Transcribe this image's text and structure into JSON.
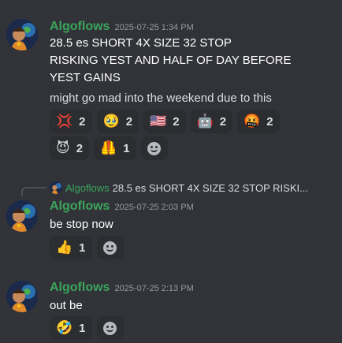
{
  "colors": {
    "background": "#313338",
    "author": "#3ba55c",
    "timestamp": "#949ba4",
    "reaction_bg": "#2b2d31"
  },
  "messages": [
    {
      "author": "Algoflows",
      "timestamp": "2025-07-25 1:34 PM",
      "lines": [
        "28.5 es SHORT 4X SIZE 32 STOP",
        "RISKING YEST  AND HALF OF DAY BEFORE",
        "YEST GAINS",
        "might go mad into the weekend due to this"
      ],
      "reactions_row1": [
        {
          "emoji": "💢",
          "icon": "anger-icon",
          "count": "2"
        },
        {
          "emoji": "🥹",
          "icon": "holding-back-tears-icon",
          "count": "2"
        },
        {
          "emoji": "🇺🇸",
          "icon": "us-flag-icon",
          "count": "2"
        },
        {
          "emoji": "🤖",
          "icon": "robot-icon",
          "count": "2"
        },
        {
          "emoji": "🤬",
          "icon": "cursing-face-icon",
          "count": "2"
        }
      ],
      "reactions_row2": [
        {
          "emoji": "😈",
          "icon": "smiling-devil-icon",
          "count": "2"
        },
        {
          "emoji": "🦺",
          "icon": "safety-vest-icon",
          "count": "1"
        }
      ]
    },
    {
      "reply_to": {
        "author": "Algoflows",
        "text": "28.5 es SHORT 4X SIZE 32 STOP RISKI..."
      },
      "author": "Algoflows",
      "timestamp": "2025-07-25 2:03 PM",
      "lines": [
        "be stop now"
      ],
      "reactions": [
        {
          "emoji": "👍",
          "icon": "thumbs-up-icon",
          "count": "1"
        }
      ]
    },
    {
      "author": "Algoflows",
      "timestamp": "2025-07-25 2:13 PM",
      "lines": [
        "out be"
      ],
      "reactions": [
        {
          "emoji": "🤣",
          "icon": "rolling-laughing-icon",
          "count": "1"
        }
      ]
    }
  ]
}
